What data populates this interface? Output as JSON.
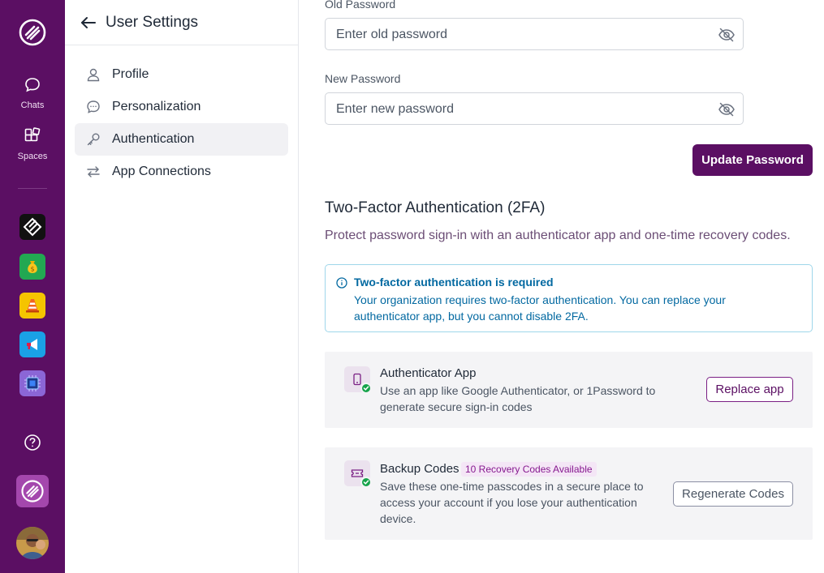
{
  "rail": {
    "chats_label": "Chats",
    "spaces_label": "Spaces",
    "apps": [
      {
        "name": "app-black",
        "color": "#111111"
      },
      {
        "name": "app-green-money",
        "color": "#22a852"
      },
      {
        "name": "app-yellow-cone",
        "color": "#f5c400"
      },
      {
        "name": "app-blue-megaphone",
        "color": "#1aa1e6"
      },
      {
        "name": "app-purple-chip",
        "color": "#8b66d6"
      }
    ]
  },
  "nav": {
    "title": "User Settings",
    "items": [
      {
        "label": "Profile",
        "icon": "user-icon"
      },
      {
        "label": "Personalization",
        "icon": "chat-bubble-icon"
      },
      {
        "label": "Authentication",
        "icon": "key-icon",
        "active": true
      },
      {
        "label": "App Connections",
        "icon": "arrows-swap-icon"
      }
    ]
  },
  "password": {
    "old_label": "Old Password",
    "old_placeholder": "Enter old password",
    "new_label": "New Password",
    "new_placeholder": "Enter new password",
    "update_button": "Update Password"
  },
  "twofa": {
    "heading": "Two-Factor Authentication (2FA)",
    "description": "Protect password sign-in with an authenticator app and one-time recovery codes.",
    "alert_title": "Two-factor authentication is required",
    "alert_body": "Your organization requires two-factor authentication. You can replace your authenticator app, but you cannot disable 2FA.",
    "authenticator": {
      "title": "Authenticator App",
      "description": "Use an app like Google Authenticator, or 1Password to generate secure sign-in codes",
      "button": "Replace app"
    },
    "backup": {
      "title": "Backup Codes",
      "badge": "10 Recovery Codes Available",
      "description": "Save these one-time passcodes in a secure place to access your account if you lose your authentication device.",
      "button": "Regenerate Codes"
    }
  },
  "colors": {
    "brand": "#5b0f63",
    "info": "#0369a1",
    "success": "#16a34a"
  }
}
